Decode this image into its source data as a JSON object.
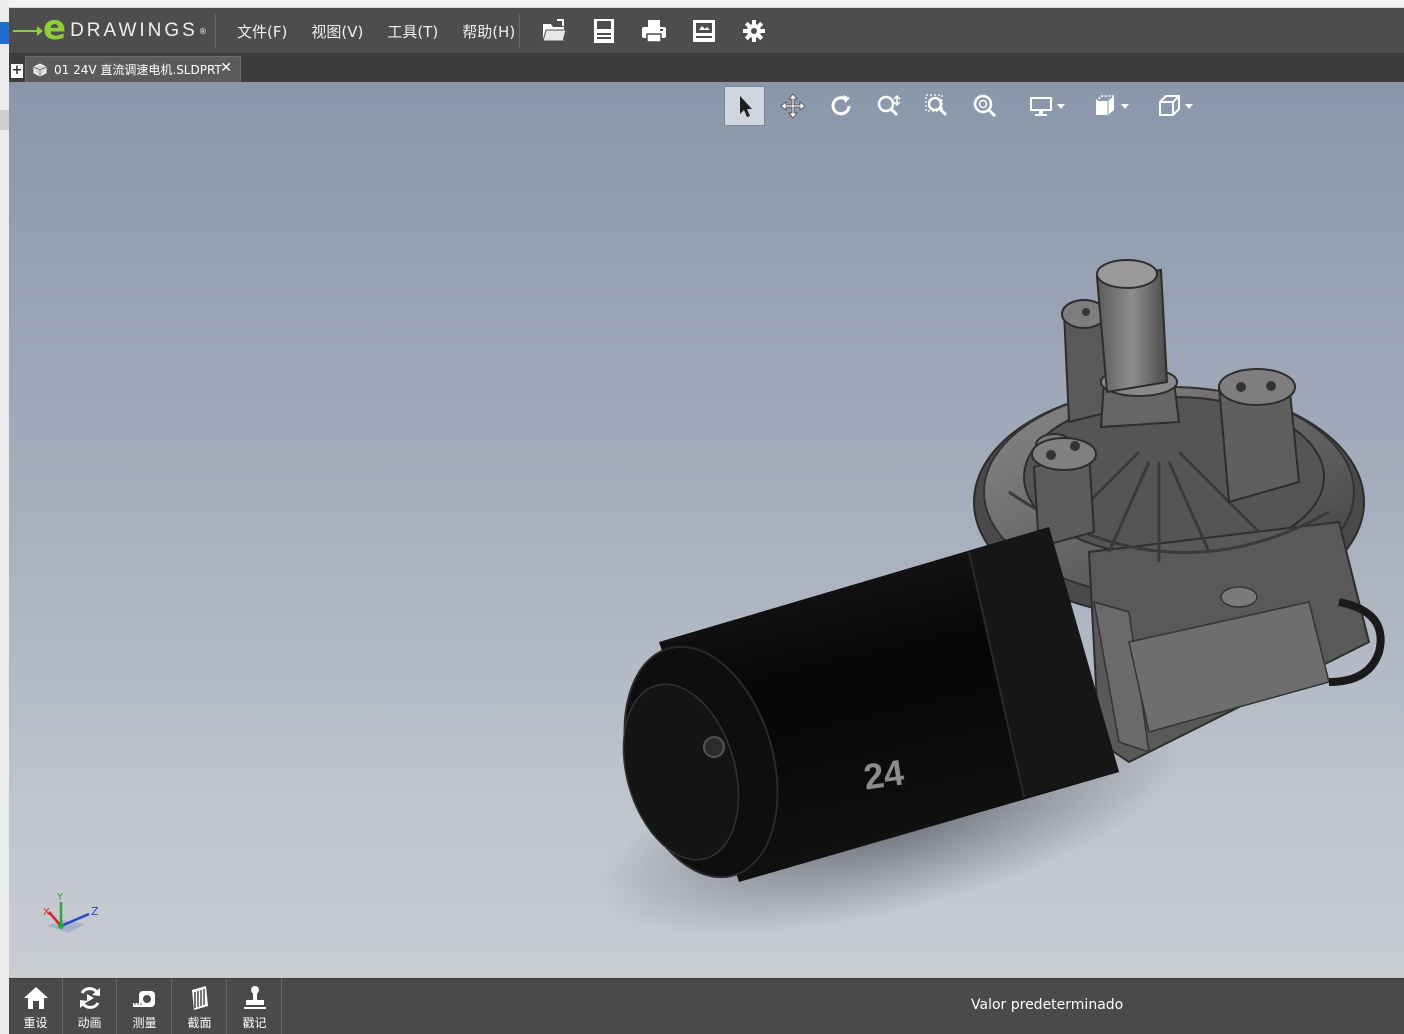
{
  "app": {
    "logo_text": "DRAWINGS",
    "logo_mark": "e",
    "logo_registered": "®"
  },
  "menu": {
    "file": "文件(F)",
    "view": "视图(V)",
    "tools": "工具(T)",
    "help": "帮助(H)"
  },
  "toolbar": {
    "icons": [
      "open-folder-icon",
      "save-icon",
      "print-icon",
      "publish-icon",
      "settings-gear-icon"
    ]
  },
  "tabs": {
    "add_label": "+",
    "document_title": "01 24V 直流调速电机.SLDPRT",
    "close_label": "✕"
  },
  "view_toolbar": {
    "icons": [
      "select-arrow-icon",
      "pan-icon",
      "rotate-icon",
      "zoom-icon",
      "zoom-to-area-icon",
      "zoom-to-fit-icon",
      "display-monitor-icon",
      "display-style-icon",
      "view-orientation-icon"
    ]
  },
  "model": {
    "label": "24"
  },
  "triad": {
    "x_label": "X",
    "y_label": "Y",
    "z_label": "Z"
  },
  "bottom": {
    "buttons": [
      {
        "label": "重设"
      },
      {
        "label": "动画"
      },
      {
        "label": "测量"
      },
      {
        "label": "截面"
      },
      {
        "label": "戳记"
      }
    ],
    "status": "Valor predeterminado"
  },
  "colors": {
    "accent_green": "#8fd03a",
    "chrome_dark": "#4a4a4a",
    "viewport_top": "#8a97aa",
    "viewport_bottom": "#c9ccd1"
  }
}
